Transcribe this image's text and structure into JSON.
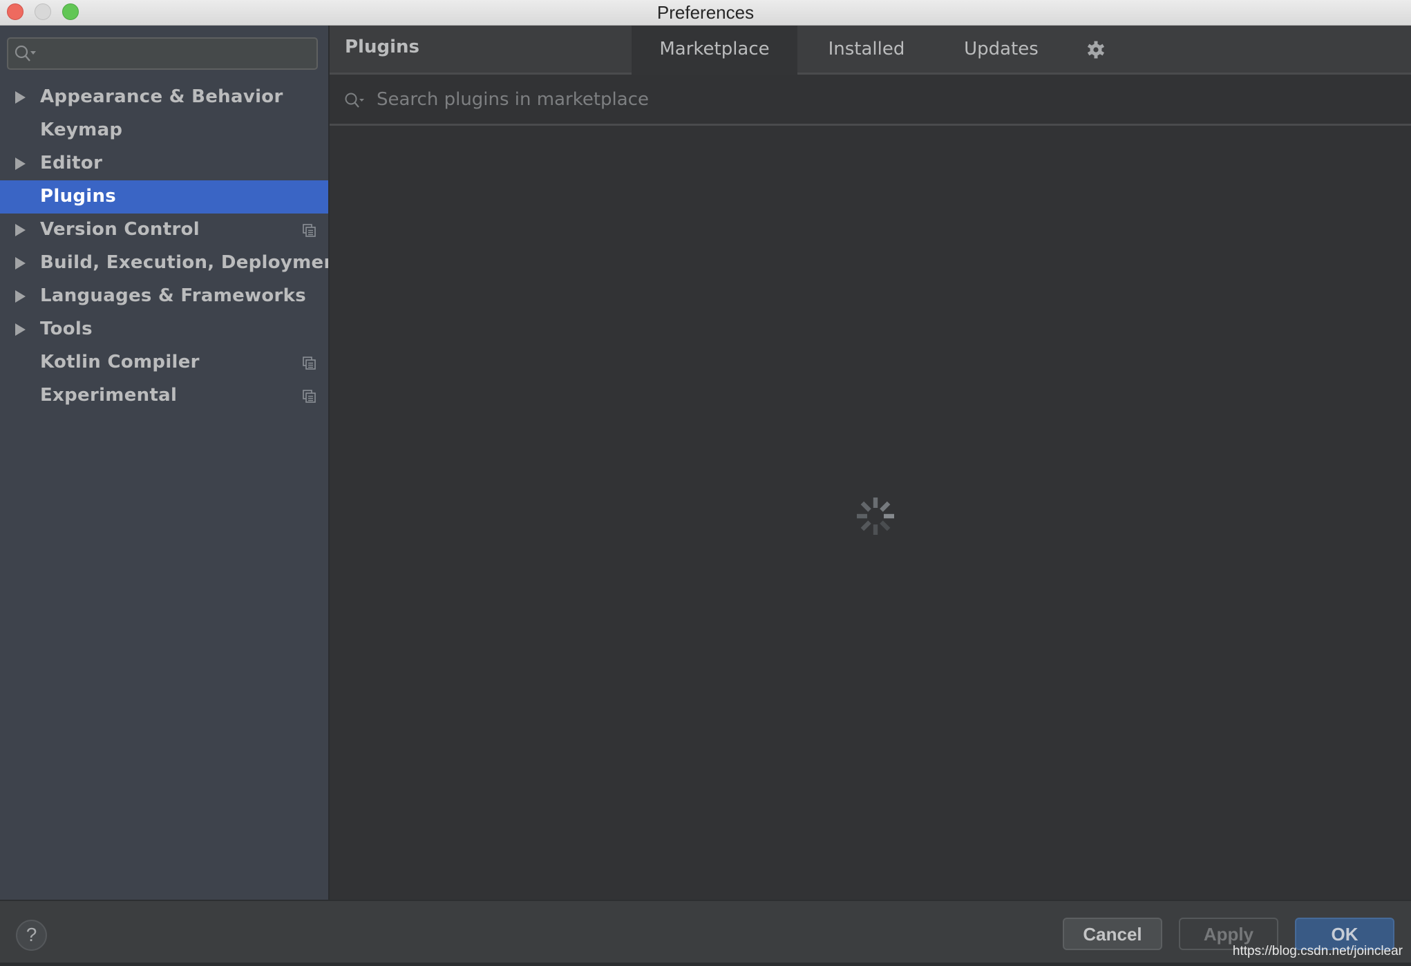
{
  "window": {
    "title": "Preferences",
    "controls": [
      "close",
      "minimize",
      "zoom"
    ]
  },
  "sidebar": {
    "search": {
      "value": "",
      "placeholder": "",
      "icon": "search-icon"
    },
    "items": [
      {
        "label": "Appearance & Behavior",
        "expandable": true,
        "selected": false,
        "project_icon": false
      },
      {
        "label": "Keymap",
        "expandable": false,
        "selected": false,
        "project_icon": false
      },
      {
        "label": "Editor",
        "expandable": true,
        "selected": false,
        "project_icon": false
      },
      {
        "label": "Plugins",
        "expandable": false,
        "selected": true,
        "project_icon": false
      },
      {
        "label": "Version Control",
        "expandable": true,
        "selected": false,
        "project_icon": true
      },
      {
        "label": "Build, Execution, Deployment",
        "expandable": true,
        "selected": false,
        "project_icon": false
      },
      {
        "label": "Languages & Frameworks",
        "expandable": true,
        "selected": false,
        "project_icon": false
      },
      {
        "label": "Tools",
        "expandable": true,
        "selected": false,
        "project_icon": false
      },
      {
        "label": "Kotlin Compiler",
        "expandable": false,
        "selected": false,
        "project_icon": true
      },
      {
        "label": "Experimental",
        "expandable": false,
        "selected": false,
        "project_icon": true
      }
    ]
  },
  "main": {
    "title": "Plugins",
    "tabs": [
      {
        "label": "Marketplace",
        "active": true
      },
      {
        "label": "Installed",
        "active": false
      },
      {
        "label": "Updates",
        "active": false
      }
    ],
    "settings_icon": "gear-icon",
    "search": {
      "value": "",
      "placeholder": "Search plugins in marketplace"
    },
    "status": "loading"
  },
  "footer": {
    "help_label": "?",
    "cancel_label": "Cancel",
    "apply_label": "Apply",
    "ok_label": "OK",
    "apply_enabled": false
  },
  "watermark": "https://blog.csdn.net/joinclear",
  "colors": {
    "selection": "#3a65c5",
    "ok_button": "#395a85"
  }
}
